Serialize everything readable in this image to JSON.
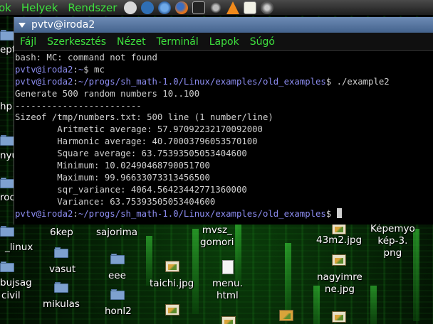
{
  "top_panel": {
    "menus": [
      "ok",
      "Helyek",
      "Rendszer"
    ],
    "launchers": [
      "network-icon",
      "update-icon",
      "browser-icon",
      "firefox-icon",
      "terminal-icon",
      "satellite-icon",
      "vlc-icon",
      "text-editor-icon",
      "music-icon"
    ]
  },
  "terminal": {
    "title": "pvtv@iroda2",
    "menu": [
      "Fájl",
      "Szerkesztés",
      "Nézet",
      "Terminál",
      "Lapok",
      "Súgó"
    ],
    "lines": [
      {
        "text": "bash: MC: command not found"
      },
      {
        "user": "pvtv@iroda2",
        "sep": ":",
        "path": "~",
        "rest": "$ mc"
      },
      {
        "user": "pvtv@iroda2",
        "sep": ":",
        "path": "~/progs/sh_math-1.0/Linux/examples/old_examples",
        "rest": "$ ./example2"
      },
      {
        "text": "Generate 500 random numbers 10..100"
      },
      {
        "text": "------------------------"
      },
      {
        "text": "Sizeof /tmp/numbers.txt: 500 line (1 number/line)"
      },
      {
        "text": "        Aritmetic average: 57.97092232170092000"
      },
      {
        "text": "        Harmonic average: 40.70003796053570100"
      },
      {
        "text": "        Square average: 63.75393505053404600"
      },
      {
        "text": "        Minimum: 10.02490468790051700"
      },
      {
        "text": "        Maximum: 99.96633073313456500"
      },
      {
        "text": "        sqr_variance: 4064.56423442771360000"
      },
      {
        "text": "        Variance: 63.75393505053404600"
      },
      {
        "user": "pvtv@iroda2",
        "sep": ":",
        "path": "~/progs/sh_math-1.0/Linux/examples/old_examples",
        "rest": "$ "
      }
    ]
  },
  "desktop": {
    "left_edge_labels": [
      "eptı",
      "hp",
      "nyu",
      "roc",
      "_linux",
      "bujsag",
      "civil"
    ],
    "icons": {
      "kep6": "6kep",
      "sajorima": "sajorima",
      "mvsz": "mvsz_\ngomori",
      "m43m2": "43m2.jpg",
      "kepemyo": "Képemyo\nkép-3.\npng",
      "vasut": "vasut",
      "eee": "eee",
      "nagyimre": "nagyimre\nne.jpg",
      "taichi": "taichi.jpg",
      "menu": "menu.\nhtml",
      "mikulas": "mikulas",
      "honl2": "honl2"
    }
  }
}
